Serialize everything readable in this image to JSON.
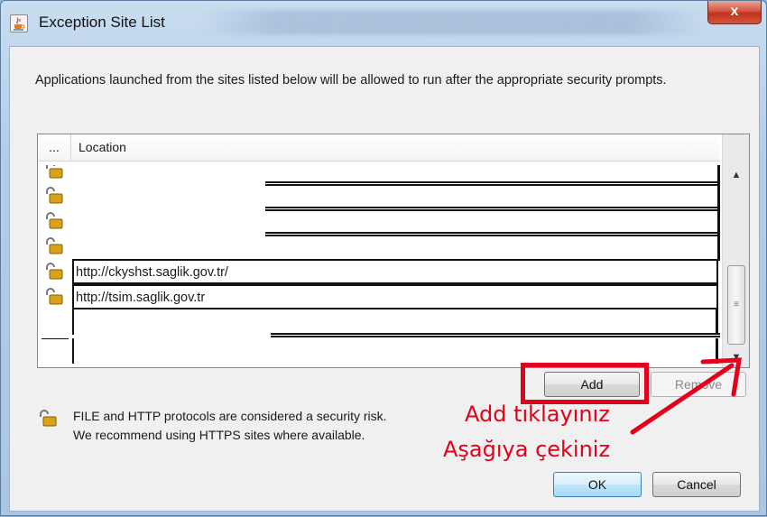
{
  "window": {
    "title": "Exception Site List",
    "close_label": "x"
  },
  "description": "Applications launched from the sites listed below will be allowed to run after the appropriate security prompts.",
  "table": {
    "columns": [
      "...",
      "Location"
    ],
    "rows": [
      {
        "location": ""
      },
      {
        "location": ""
      },
      {
        "location": ""
      },
      {
        "location": ""
      },
      {
        "location": "http://ckyshst.saglik.gov.tr/"
      },
      {
        "location": "http://tsim.saglik.gov.tr"
      },
      {
        "location": ""
      },
      {
        "location": ""
      }
    ]
  },
  "buttons": {
    "add": "Add",
    "remove": "Remove",
    "ok": "OK",
    "cancel": "Cancel"
  },
  "warning": {
    "line1": "FILE and HTTP protocols are considered a security risk.",
    "line2": "We recommend using HTTPS sites where available."
  },
  "annotations": {
    "line1": "Add tıklayınız",
    "line2": "Aşağıya çekiniz"
  },
  "colors": {
    "annotation_red": "#e2001a",
    "lock_gold": "#d9a21b"
  },
  "icons": {
    "title": "java-cup-icon",
    "row": "unlocked-padlock-icon"
  }
}
